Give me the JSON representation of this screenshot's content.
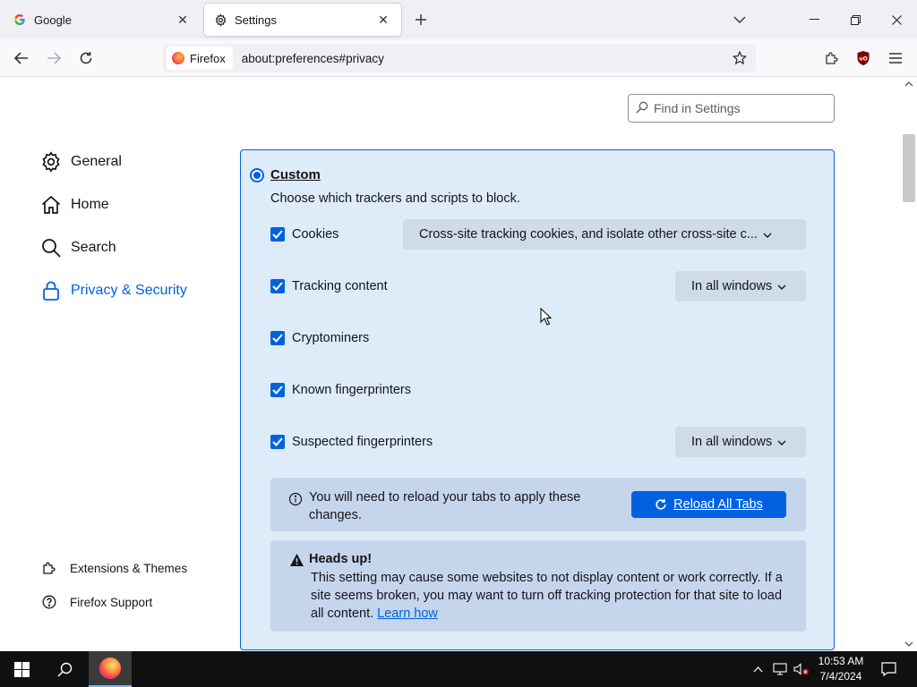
{
  "browser": {
    "tabs": [
      {
        "title": "Google",
        "favicon": "google-g-icon",
        "active": false
      },
      {
        "title": "Settings",
        "favicon": "gear-icon",
        "active": true
      }
    ],
    "identity_label": "Firefox",
    "url": "about:preferences#privacy"
  },
  "settings": {
    "search_placeholder": "Find in Settings",
    "categories": [
      {
        "label": "General",
        "icon": "gear-icon",
        "selected": false
      },
      {
        "label": "Home",
        "icon": "home-icon",
        "selected": false
      },
      {
        "label": "Search",
        "icon": "magnifier-icon",
        "selected": false
      },
      {
        "label": "Privacy & Security",
        "icon": "lock-icon",
        "selected": true
      }
    ],
    "footer_links": [
      {
        "label": "Extensions & Themes",
        "icon": "puzzle-icon"
      },
      {
        "label": "Firefox Support",
        "icon": "help-icon"
      }
    ],
    "custom": {
      "label": "Custom",
      "description": "Choose which trackers and scripts to block.",
      "options": [
        {
          "label": "Cookies",
          "checked": true,
          "dropdown": "Cross-site tracking cookies, and isolate other cross-site c..."
        },
        {
          "label": "Tracking content",
          "checked": true,
          "dropdown": "In all windows"
        },
        {
          "label": "Cryptominers",
          "checked": true,
          "dropdown": null
        },
        {
          "label": "Known fingerprinters",
          "checked": true,
          "dropdown": null
        },
        {
          "label": "Suspected fingerprinters",
          "checked": true,
          "dropdown": "In all windows"
        }
      ],
      "reload_message": "You will need to reload your tabs to apply these changes.",
      "reload_button": "Reload All Tabs",
      "warning_title": "Heads up!",
      "warning_body": "This setting may cause some websites to not display content or work correctly. If a site seems broken, you may want to turn off tracking protection for that site to load all content.",
      "warning_link": "Learn how"
    }
  },
  "taskbar": {
    "time": "10:53 AM",
    "date": "7/4/2024"
  },
  "colors": {
    "accent": "#0061e0",
    "panel_bg": "#deebf9",
    "notice_bg": "#c5d6ec"
  }
}
